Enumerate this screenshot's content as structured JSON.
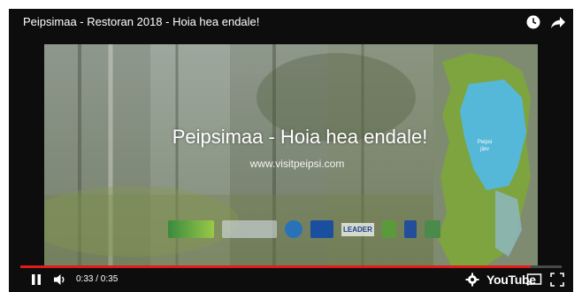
{
  "video": {
    "title": "Peipsimaa - Restoran 2018 - Hoia hea endale!",
    "overlay_title": "Peipsimaa - Hoia hea endale!",
    "overlay_url": "www.visitpeipsi.com",
    "map_label_1": "Peipsi",
    "map_label_2": "järv",
    "logo_text_leader": "LEADER"
  },
  "player": {
    "time": "0:33 / 0:35",
    "progress": 0.943,
    "youtube_label": "YouTube",
    "accent_color": "#e01b1b"
  }
}
